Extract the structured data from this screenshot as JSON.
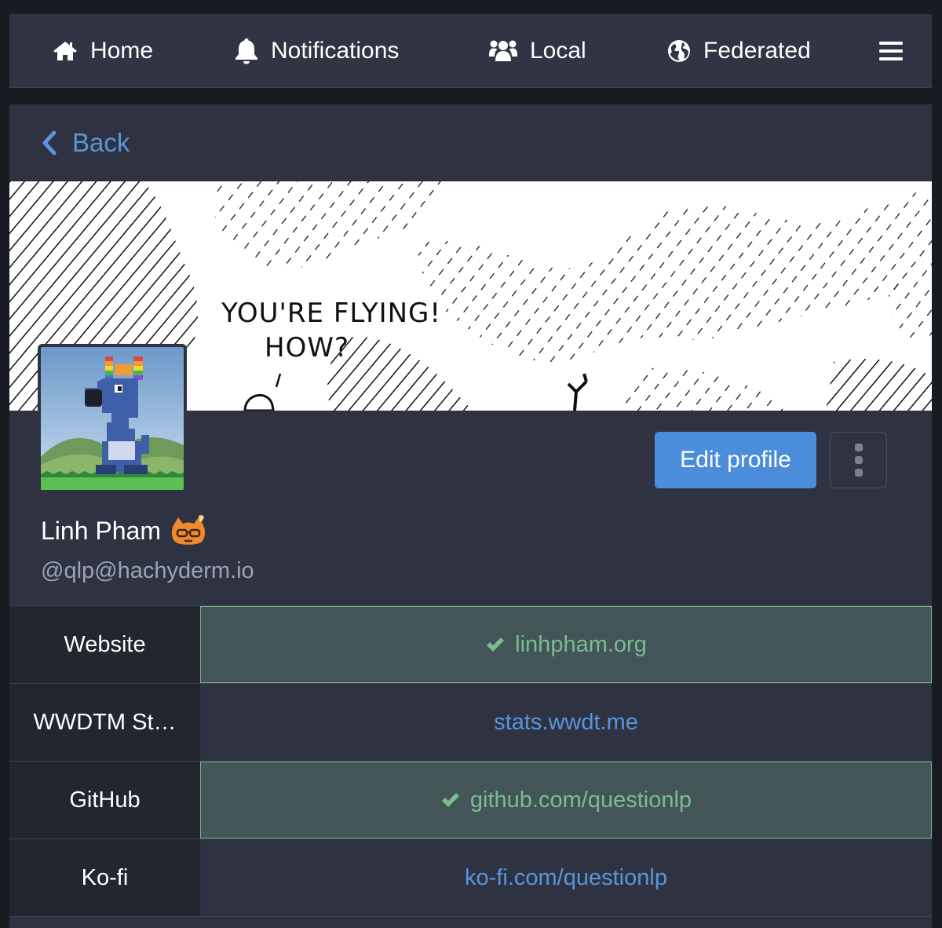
{
  "nav": {
    "home": "Home",
    "notifications": "Notifications",
    "local": "Local",
    "federated": "Federated"
  },
  "back": {
    "label": "Back"
  },
  "header": {
    "comic_line1": "YOU'RE FLYING!",
    "comic_line2": "HOW?"
  },
  "profile": {
    "display_name": "Linh Pham",
    "handle": "@qlp@hachyderm.io",
    "edit_label": "Edit profile"
  },
  "fields": [
    {
      "name": "Website",
      "value": "linhpham.org",
      "verified": true
    },
    {
      "name": "WWDTM St…",
      "value": "stats.wwdt.me",
      "verified": false
    },
    {
      "name": "GitHub",
      "value": "github.com/questionlp",
      "verified": true
    },
    {
      "name": "Ko-fi",
      "value": "ko-fi.com/questionlp",
      "verified": false
    }
  ],
  "colors": {
    "accent": "#4b8ddb",
    "link": "#5895dd",
    "verified": "#79bd94",
    "background": "#191b22",
    "panel": "#2f3341"
  },
  "icons": [
    "home-icon",
    "bell-icon",
    "users-icon",
    "globe-icon",
    "hamburger-icon",
    "chevron-left-icon",
    "check-icon",
    "ellipsis-vertical-icon"
  ]
}
